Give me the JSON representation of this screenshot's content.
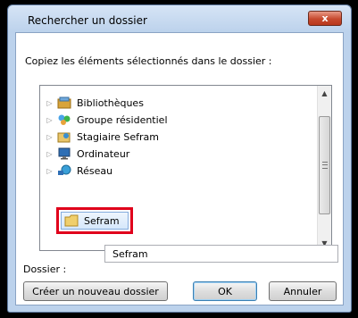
{
  "window": {
    "title": "Rechercher un dossier",
    "close_label": "x"
  },
  "instruction": "Copiez les éléments sélectionnés dans le dossier :",
  "tree": {
    "items": [
      {
        "label": "Bibliothèques",
        "icon": "libraries-icon"
      },
      {
        "label": "Groupe résidentiel",
        "icon": "homegroup-icon"
      },
      {
        "label": "Stagiaire Sefram",
        "icon": "user-folder-icon"
      },
      {
        "label": "Ordinateur",
        "icon": "computer-icon"
      },
      {
        "label": "Réseau",
        "icon": "network-icon"
      },
      {
        "label": "Sefram",
        "icon": "folder-icon",
        "selected": true
      }
    ]
  },
  "folder_field": {
    "label": "Dossier :",
    "value": "Sefram"
  },
  "buttons": {
    "new_folder": "Créer un nouveau dossier",
    "ok": "OK",
    "cancel": "Annuler"
  },
  "colors": {
    "highlight": "#e0001b",
    "selection": "#d6e8fb",
    "frame": "#bcd2ec"
  }
}
